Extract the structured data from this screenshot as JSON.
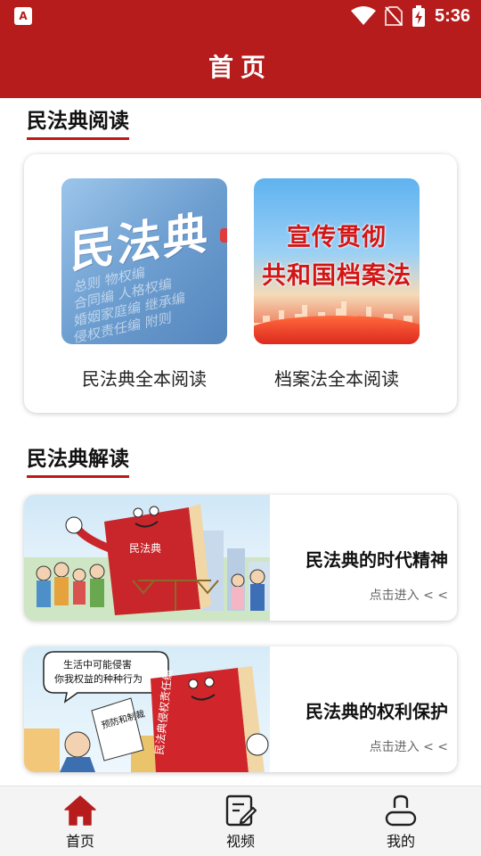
{
  "status_bar": {
    "time": "5:36",
    "app_glyph": "A"
  },
  "app_bar": {
    "title": "首页"
  },
  "sections": {
    "reading_title": "民法典阅读",
    "interpretation_title": "民法典解读"
  },
  "reading": {
    "items": [
      {
        "label": "民法典全本阅读",
        "cover_text": "民法典",
        "cover_lines": [
          "总则 物权编",
          "合同编 人格权编",
          "婚姻家庭编 继承编",
          "侵权责任编 附则"
        ]
      },
      {
        "label": "档案法全本阅读",
        "cover_text_1": "宣传贯彻",
        "cover_text_2": "共和国档案法"
      }
    ]
  },
  "interpretation": {
    "items": [
      {
        "title": "民法典的时代精神",
        "enter_label": "点击进入 < <",
        "book_label": "民法典"
      },
      {
        "title": "民法典的权利保护",
        "enter_label": "点击进入 < <",
        "bubble_line_1": "生活中可能侵害",
        "bubble_line_2": "你我权益的种种行为",
        "book_label": "民法典侵权责任编",
        "sign_label": "预防和制裁"
      }
    ]
  },
  "bottom_nav": {
    "items": [
      {
        "label": "首页",
        "icon": "home-icon",
        "active": true
      },
      {
        "label": "视频",
        "icon": "edit-icon",
        "active": false
      },
      {
        "label": "我的",
        "icon": "user-icon",
        "active": false
      }
    ]
  },
  "colors": {
    "primary": "#b61c1c",
    "accent_underline": "#c01818"
  }
}
